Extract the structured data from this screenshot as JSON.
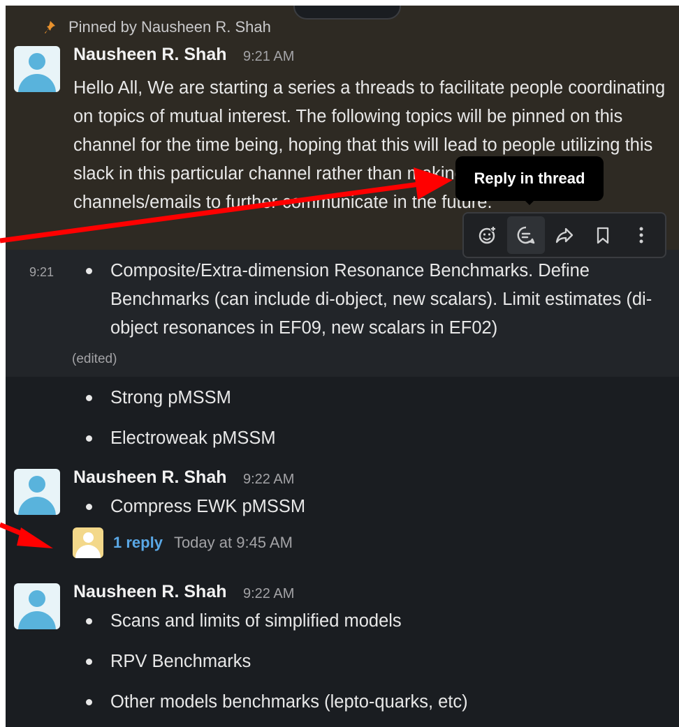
{
  "pinned_label": "Pinned by Nausheen R. Shah",
  "tooltip": "Reply in thread",
  "messages": [
    {
      "author": "Nausheen R. Shah",
      "time": "9:21 AM",
      "text": "Hello All, We are starting a series a threads to facilitate people coordinating on topics of mutual interest. The following topics will be pinned on this channel for the time being, hoping that this will lead to people utilizing this slack in this particular channel rather than making their own private channels/emails to further communicate in the future."
    },
    {
      "side_time": "9:21",
      "bullet": "Composite/Extra-dimension Resonance Benchmarks.  Define Benchmarks (can include di-object, new scalars). Limit estimates (di-object resonances in EF09, new scalars in EF02)",
      "edited": "(edited)"
    },
    {
      "bullet": "Strong pMSSM"
    },
    {
      "bullet": "Electroweak pMSSM"
    },
    {
      "author": "Nausheen R. Shah",
      "time": "9:22 AM",
      "bullet": "Compress EWK pMSSM",
      "reply_count": "1 reply",
      "reply_time": "Today at 9:45 AM"
    },
    {
      "author": "Nausheen R. Shah",
      "time": "9:22 AM",
      "bullets": [
        "Scans and limits of simplified models",
        "RPV Benchmarks",
        "Other models benchmarks (lepto-quarks, etc)"
      ]
    }
  ],
  "toolbar_icons": [
    "add-reaction-icon",
    "reply-in-thread-icon",
    "share-icon",
    "bookmark-icon",
    "more-actions-icon"
  ],
  "colors": {
    "background": "#1a1d21",
    "pinned_background": "#2e2a23",
    "hover_background": "#222529",
    "link": "#5aa8e6",
    "annotation_arrow": "#ff0000",
    "pin": "#e8912d"
  }
}
